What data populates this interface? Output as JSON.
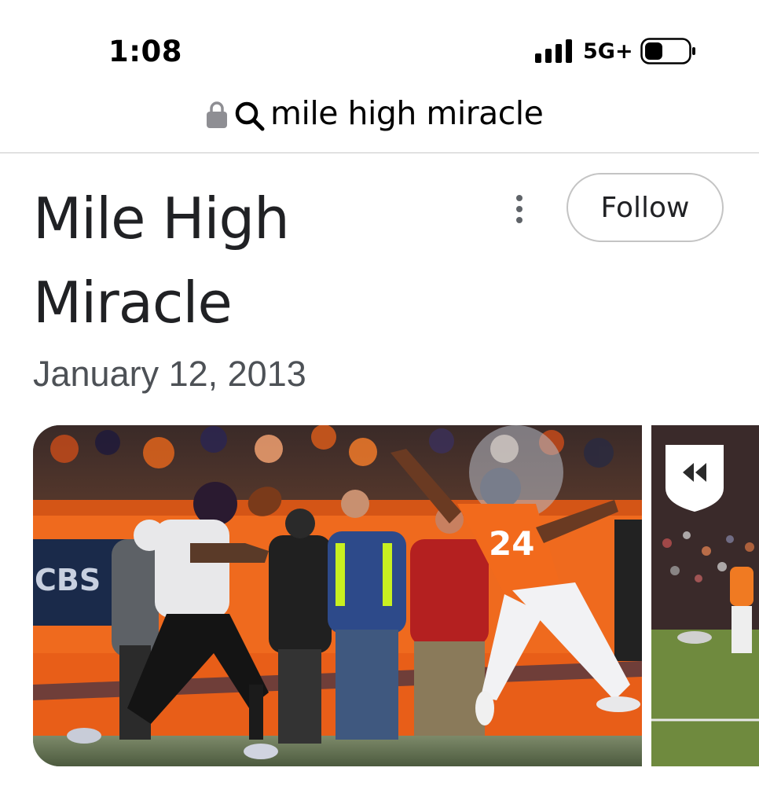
{
  "status_bar": {
    "time": "1:08",
    "network": "5G+",
    "icons": [
      "signal-icon",
      "battery-icon"
    ]
  },
  "url_bar": {
    "query": "mile high miracle",
    "icons": [
      "lock-icon",
      "search-icon"
    ]
  },
  "header": {
    "title": "Mile High Miracle",
    "follow_label": "Follow",
    "date": "January 12, 2013",
    "icons": [
      "more-vertical-icon"
    ]
  },
  "images": {
    "main_alt": "Ravens receiver catching a pass as Broncos defender #24 leaps",
    "side_alt": "Field view with NFL shield logo",
    "main_jersey": "24",
    "broadcast_logo": "CBS"
  },
  "colors": {
    "broncos_orange": "#f26a1c",
    "follow_border": "#c4c4c4",
    "date_gray": "#4d5156"
  }
}
